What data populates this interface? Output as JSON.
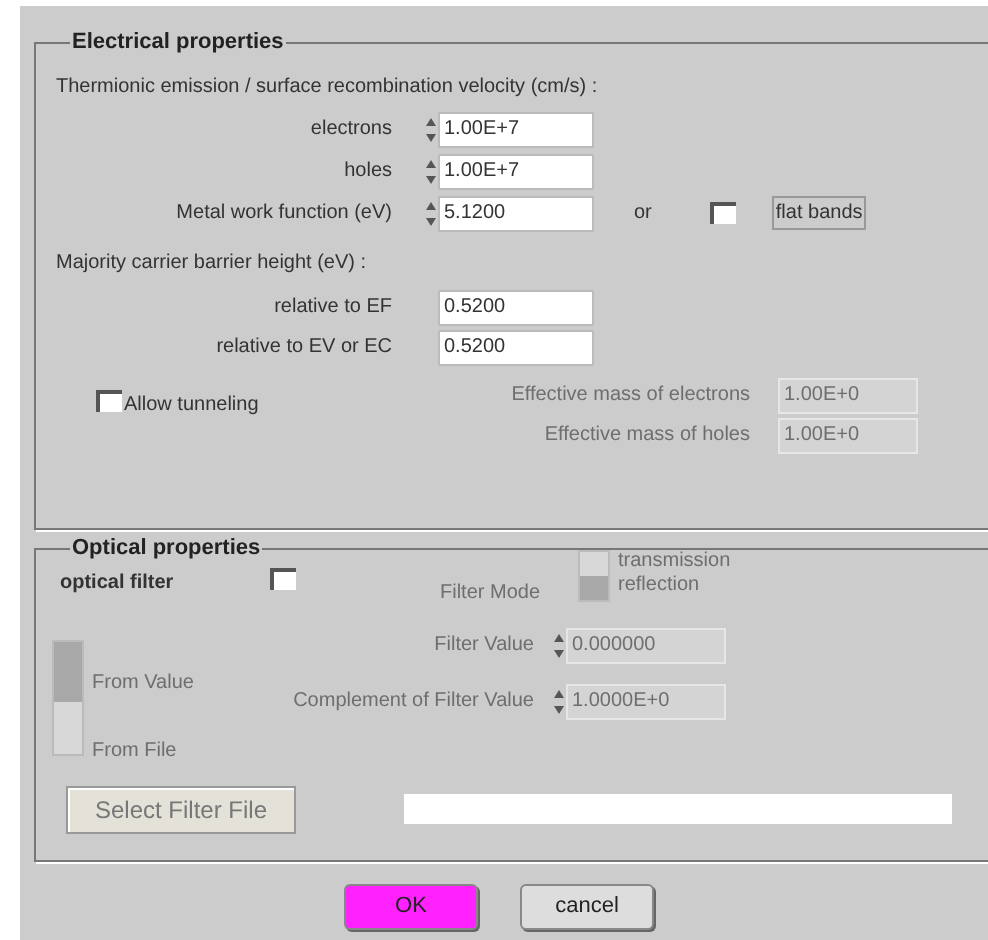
{
  "electrical": {
    "title": "Electrical properties",
    "emission_heading": "Thermionic emission / surface recombination velocity (cm/s) :",
    "emission_rows": [
      {
        "label": "electrons",
        "value": "1.00E+7"
      },
      {
        "label": "holes",
        "value": "1.00E+7"
      },
      {
        "label": "Metal work function (eV)",
        "value": "5.1200"
      }
    ],
    "or_label": "or",
    "flat_bands": {
      "checked": false,
      "label": "flat bands"
    },
    "barrier_heading": "Majority carrier barrier height (eV) :",
    "barrier_rows": [
      {
        "label": "relative to EF",
        "value": "0.5200"
      },
      {
        "label": "relative to EV or EC",
        "value": "0.5200"
      }
    ],
    "tunneling": {
      "label": "Allow tunneling",
      "checked": false
    },
    "mass_rows": [
      {
        "label": "Effective mass of electrons",
        "value": "1.00E+0",
        "disabled": true
      },
      {
        "label": "Effective mass of holes",
        "value": "1.00E+0",
        "disabled": true
      }
    ]
  },
  "optical": {
    "title": "Optical properties",
    "filter": {
      "label": "optical filter",
      "checked": false
    },
    "filter_mode": {
      "label": "Filter Mode",
      "disabled": true,
      "options": [
        {
          "label": "transmission",
          "selected": false
        },
        {
          "label": "reflection",
          "selected": true
        }
      ]
    },
    "source": {
      "disabled": true,
      "options": [
        {
          "label": "From Value",
          "selected": true
        },
        {
          "label": "From File",
          "selected": false
        }
      ]
    },
    "filter_value": {
      "label": "Filter Value",
      "value": "0.000000",
      "disabled": true
    },
    "complement": {
      "label": "Complement of Filter Value",
      "value": "1.0000E+0",
      "disabled": true
    },
    "select_button": {
      "label": "Select Filter File",
      "disabled": true
    }
  },
  "buttons": [
    {
      "label": "OK",
      "kind": "primary"
    },
    {
      "label": "cancel",
      "kind": "normal"
    }
  ]
}
